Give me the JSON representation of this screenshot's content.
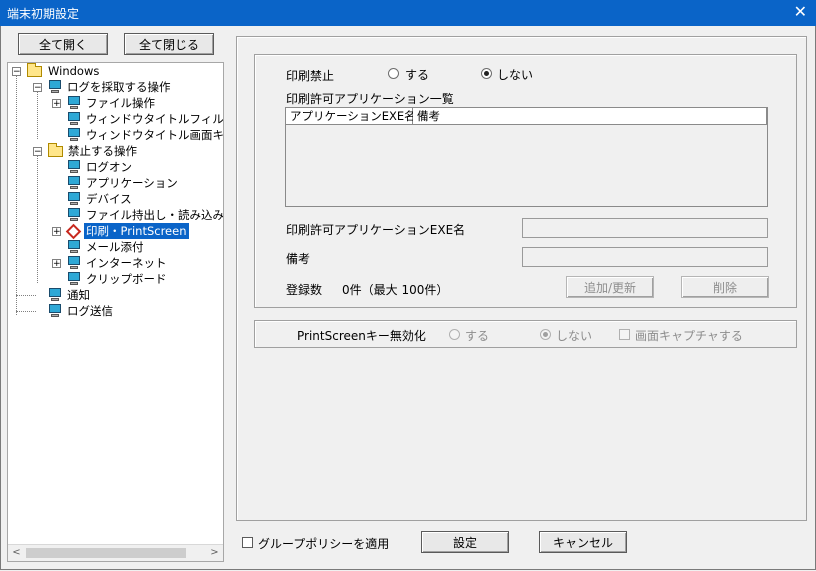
{
  "window": {
    "title": "端末初期設定",
    "close_icon": "✕"
  },
  "toolbar": {
    "expand_all": "全て開く",
    "collapse_all": "全て閉じる"
  },
  "tree": {
    "root": "Windows",
    "log_ops": "ログを採取する操作",
    "file_ops": "ファイル操作",
    "window_title_filter": "ウィンドウタイトルフィルタ",
    "window_title_capture": "ウィンドウタイトル画面キャ",
    "forbidden_ops": "禁止する操作",
    "logon": "ログオン",
    "application": "アプリケーション",
    "device": "デバイス",
    "file_io": "ファイル持出し・読み込み",
    "print": "印刷・PrintScreen",
    "mail": "メール添付",
    "internet": "インターネット",
    "clipboard": "クリップボード",
    "notify": "通知",
    "log_send": "ログ送信"
  },
  "print_panel": {
    "print_forbid_label": "印刷禁止",
    "opt_yes": "する",
    "opt_no": "しない",
    "selected": "しない",
    "app_list_label": "印刷許可アプリケーション一覧",
    "columns": [
      "アプリケーションEXE名",
      "備考"
    ],
    "rows": [],
    "exe_name_label": "印刷許可アプリケーションEXE名",
    "exe_name_value": "",
    "note_label": "備考",
    "note_value": "",
    "count_label": "登録数",
    "count_value": "0件（最大 100件）",
    "add_button": "追加/更新",
    "delete_button": "削除"
  },
  "printscreen_panel": {
    "label": "PrintScreenキー無効化",
    "opt_yes": "する",
    "opt_no": "しない",
    "selected": "しない",
    "capture_label": "画面キャプチャする",
    "capture_checked": false
  },
  "footer": {
    "group_policy_label": "グループポリシーを適用",
    "group_policy_checked": false,
    "ok_button": "設定",
    "cancel_button": "キャンセル"
  },
  "colors": {
    "title_bar": "#0a64c8",
    "selection": "#0a64c8",
    "window_bg": "#f0f0f0"
  },
  "scroll": {
    "horizontal_thumb_fraction": 0.82
  }
}
